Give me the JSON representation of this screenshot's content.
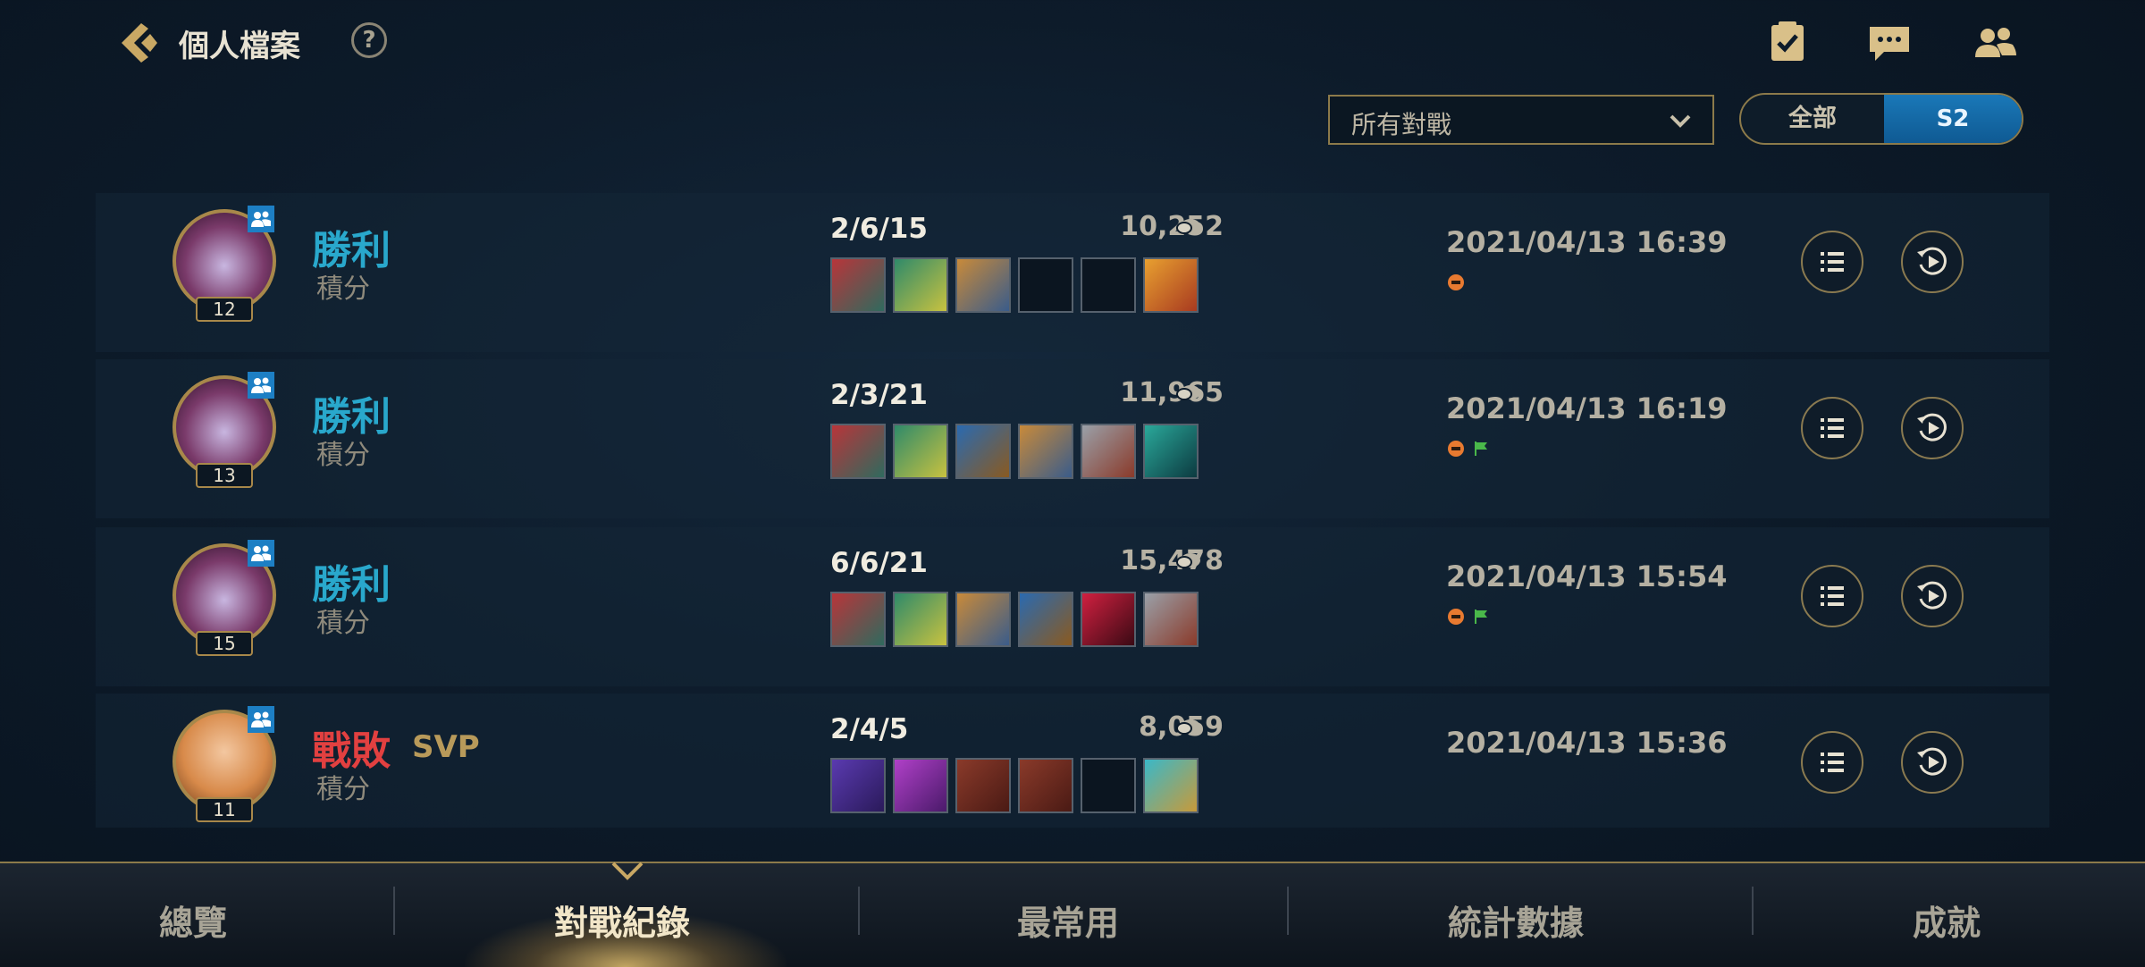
{
  "header": {
    "title": "個人檔案",
    "help_label": "?"
  },
  "filter": {
    "selected": "所有對戰"
  },
  "season_toggle": {
    "all_label": "全部",
    "season_label": "S2",
    "active": "S2"
  },
  "matches": [
    {
      "result": "勝利",
      "outcome": "win",
      "mode": "積分",
      "level": "12",
      "kda": "2/6/15",
      "gold": "10,252",
      "items": [
        "red-item",
        "green-item",
        "gold-item",
        "empty",
        "empty",
        "orange-item"
      ],
      "date": "2021/04/13 16:39",
      "badges": [
        "first-blood-badge"
      ],
      "svp": ""
    },
    {
      "result": "勝利",
      "outcome": "win",
      "mode": "積分",
      "level": "13",
      "kda": "2/3/21",
      "gold": "11,965",
      "items": [
        "red-item",
        "green-item",
        "blue-item",
        "gold-item",
        "silver-item",
        "teal-item"
      ],
      "date": "2021/04/13 16:19",
      "badges": [
        "first-blood-badge",
        "flag-badge"
      ],
      "svp": ""
    },
    {
      "result": "勝利",
      "outcome": "win",
      "mode": "積分",
      "level": "15",
      "kda": "6/6/21",
      "gold": "15,478",
      "items": [
        "red-item",
        "green-item",
        "gold-item",
        "blue-item",
        "crimson-item",
        "silver-item"
      ],
      "date": "2021/04/13 15:54",
      "badges": [
        "first-blood-badge",
        "flag-badge"
      ],
      "svp": ""
    },
    {
      "result": "戰敗",
      "outcome": "loss",
      "mode": "積分",
      "level": "11",
      "kda": "2/4/5",
      "gold": "8,059",
      "items": [
        "purple-item",
        "violet-item",
        "tome-item",
        "tome-item",
        "empty",
        "cyan-item"
      ],
      "date": "2021/04/13 15:36",
      "badges": [],
      "svp": "SVP"
    }
  ],
  "nav": {
    "tabs": [
      "總覽",
      "對戰紀錄",
      "最常用",
      "統計數據",
      "成就"
    ],
    "active": "對戰紀錄"
  },
  "colors": {
    "win": "#29a8cc",
    "loss": "#e24040",
    "accent_gold": "#8c7a4a",
    "season_active": "#1a78b8"
  }
}
